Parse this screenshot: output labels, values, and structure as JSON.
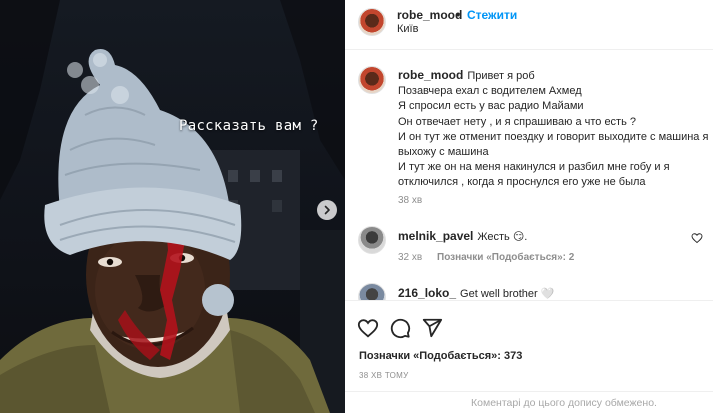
{
  "media": {
    "overlay_caption": "Рассказать вам ?",
    "next_icon": "chevron-right-icon"
  },
  "header": {
    "username": "robe_mood",
    "separator": "•",
    "follow_label": "Стежити",
    "location": "Київ"
  },
  "caption": {
    "username": "robe_mood",
    "lines": [
      "Привет я роб",
      "Позавчера ехал с водителем Ахмед",
      "Я спросил есть у вас радио Майами",
      "Он отвечает нету , и я спрашиваю а что есть ?",
      "И он тут же отменит поездку и говорит выходите с машина я",
      "выхожу с машина",
      "И тут же он на меня накинулся и разбил мне гобу и я",
      "отключился , когда я проснулся его уже не была"
    ],
    "time": "38 хв"
  },
  "comments": [
    {
      "username": "melnik_pavel",
      "text": "Жесть 😏.",
      "time": "32 хв",
      "likes_label": "Позначки «Подобається»: 2"
    },
    {
      "username": "216_loko_",
      "text": "Get well brother 🤍"
    }
  ],
  "actions": {
    "icons": [
      "heart-icon",
      "comment-icon",
      "share-icon"
    ],
    "likes": "Позначки «Подобається»: 373",
    "post_time": "38 ХВ ТОМУ",
    "comments_limited": "Коментарі до цього допису обмежено."
  },
  "colors": {
    "link_blue": "#0095f6",
    "muted_text": "#8e8e8e",
    "text": "#262626",
    "divider": "#efefef"
  }
}
